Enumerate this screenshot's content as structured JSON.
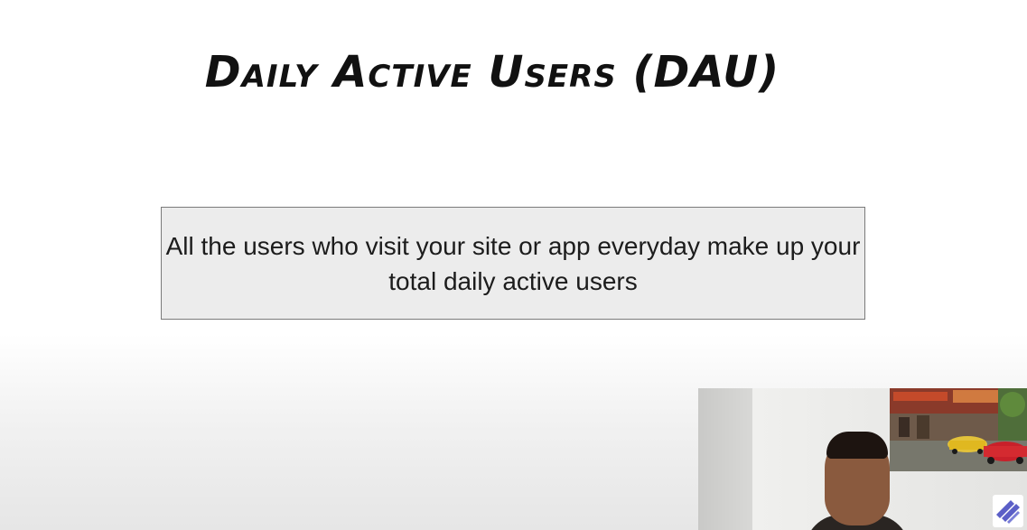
{
  "slide": {
    "title": "Daily Active Users (DAU)",
    "definition": "All the users who visit your site or app everyday make up your total daily active users"
  },
  "webcam": {
    "description_icon": "presenter-video-icon",
    "logo_icon": "channel-logo-icon"
  },
  "colors": {
    "title": "#111111",
    "box_fill": "#ececec",
    "box_border": "#7a7a7a",
    "logo": "#5b5fc7"
  }
}
